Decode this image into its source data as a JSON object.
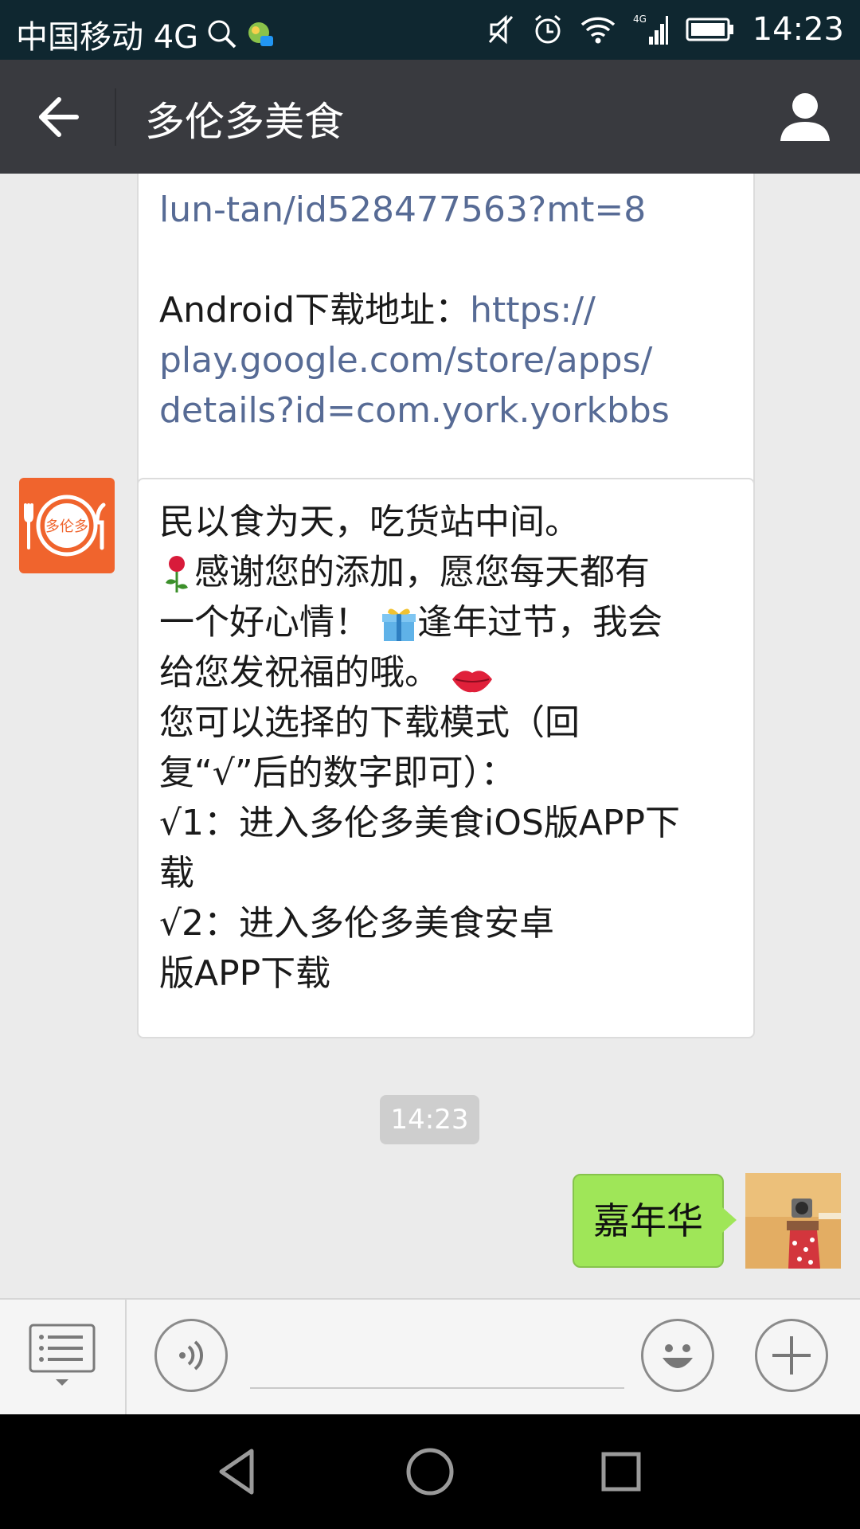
{
  "status_bar": {
    "carrier": "中国移动 4G",
    "time": "14:23"
  },
  "header": {
    "title": "多伦多美食"
  },
  "messages": {
    "m1_link_part1": "lun-tan/id528477563?mt=8",
    "m1_android_label": "Android下载地址：",
    "m1_android_link1": "https://",
    "m1_android_link2": "play.google.com/store/apps/",
    "m1_android_link3": "details?id=com.york.yorkbbs",
    "m2_line1": "民以食为天，吃货站中间。",
    "m2_line2": "感谢您的添加，愿您每天都有",
    "m2_line3": "一个好心情！",
    "m2_line3b": "逢年过节，我会",
    "m2_line4": "给您发祝福的哦。",
    "m2_line5": "您可以选择的下载模式（回",
    "m2_line6": "复“√”后的数字即可）：",
    "m2_line7": "√1：进入多伦多美食iOS版APP下",
    "m2_line8": "载",
    "m2_line9": "√2：进入多伦多美食安卓",
    "m2_line10": "版APP下载",
    "bot_avatar_text": "多伦多",
    "timestamp": "14:23",
    "my_message": "嘉年华"
  },
  "input_bar": {
    "placeholder": ""
  },
  "colors": {
    "link": "#576b95",
    "my_bubble": "#9fe658",
    "header_bg": "#393a3f",
    "bot_avatar": "#f0642d"
  },
  "icons": {
    "back": "arrow-left-icon",
    "profile": "person-icon",
    "menu": "list-menu-icon",
    "voice": "voice-icon",
    "emoji": "smiley-icon",
    "plus": "plus-icon"
  }
}
